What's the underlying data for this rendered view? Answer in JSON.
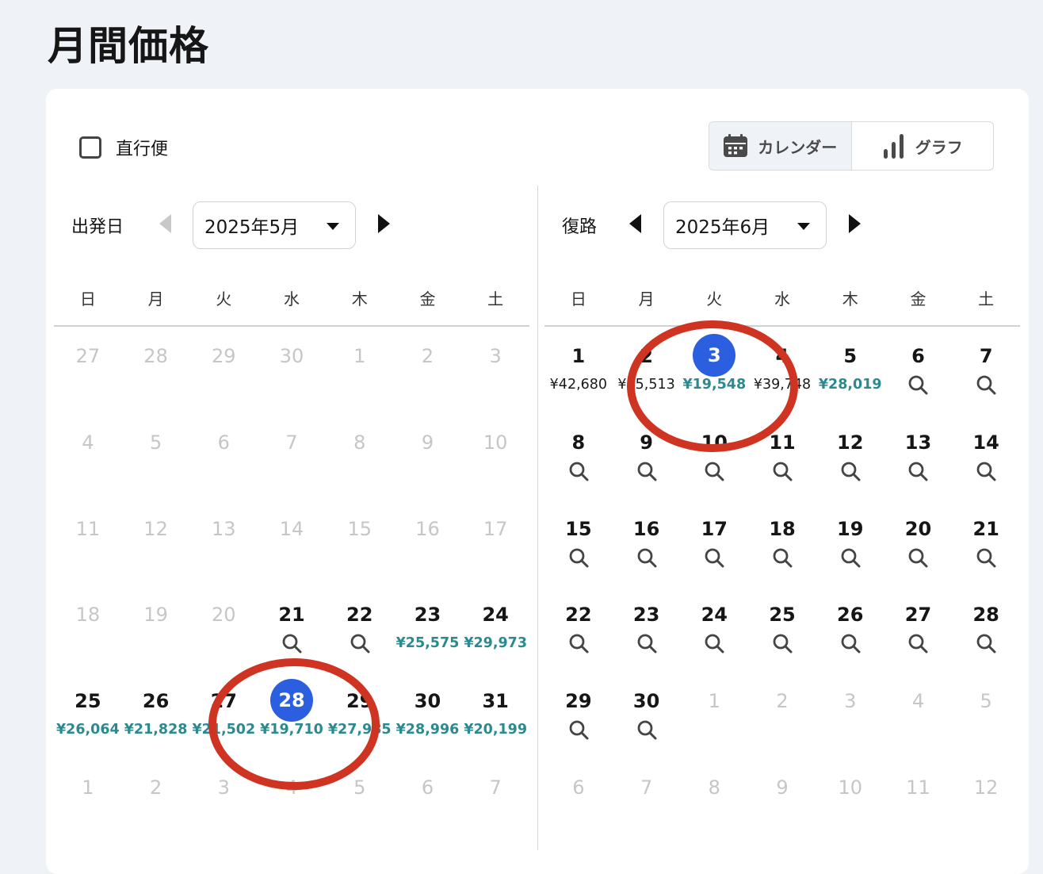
{
  "page_title": "月間価格",
  "filters": {
    "nonstop_label": "直行便",
    "nonstop_checked": false
  },
  "view_toggle": {
    "calendar_label": "カレンダー",
    "graph_label": "グラフ",
    "active": "calendar",
    "calendar_icon": "calendar-icon",
    "graph_icon": "bar-chart-icon"
  },
  "colors": {
    "accent": "#2c5fe0",
    "cheap_price": "#2b8a8f",
    "annotation": "#cf3322",
    "muted": "#c6c6c6"
  },
  "weekdays": [
    "日",
    "月",
    "火",
    "水",
    "木",
    "金",
    "土"
  ],
  "departure": {
    "label": "出発日",
    "month": "2025年5月",
    "prev_enabled": false,
    "weeks": [
      [
        {
          "d": "27",
          "muted": true
        },
        {
          "d": "28",
          "muted": true
        },
        {
          "d": "29",
          "muted": true
        },
        {
          "d": "30",
          "muted": true
        },
        {
          "d": "1",
          "muted": true
        },
        {
          "d": "2",
          "muted": true
        },
        {
          "d": "3",
          "muted": true
        }
      ],
      [
        {
          "d": "4",
          "muted": true
        },
        {
          "d": "5",
          "muted": true
        },
        {
          "d": "6",
          "muted": true
        },
        {
          "d": "7",
          "muted": true
        },
        {
          "d": "8",
          "muted": true
        },
        {
          "d": "9",
          "muted": true
        },
        {
          "d": "10",
          "muted": true
        }
      ],
      [
        {
          "d": "11",
          "muted": true
        },
        {
          "d": "12",
          "muted": true
        },
        {
          "d": "13",
          "muted": true
        },
        {
          "d": "14",
          "muted": true
        },
        {
          "d": "15",
          "muted": true
        },
        {
          "d": "16",
          "muted": true
        },
        {
          "d": "17",
          "muted": true
        }
      ],
      [
        {
          "d": "18",
          "muted": true
        },
        {
          "d": "19",
          "muted": true
        },
        {
          "d": "20",
          "muted": true
        },
        {
          "d": "21",
          "search": true
        },
        {
          "d": "22",
          "search": true
        },
        {
          "d": "23",
          "price": "¥25,575",
          "cheap": true
        },
        {
          "d": "24",
          "price": "¥29,973",
          "cheap": true
        }
      ],
      [
        {
          "d": "25",
          "price": "¥26,064",
          "cheap": true
        },
        {
          "d": "26",
          "price": "¥21,828",
          "cheap": true
        },
        {
          "d": "27",
          "price": "¥21,502",
          "cheap": true
        },
        {
          "d": "28",
          "price": "¥19,710",
          "cheap": true,
          "selected": true
        },
        {
          "d": "29",
          "price": "¥27,985",
          "cheap": true
        },
        {
          "d": "30",
          "price": "¥28,996",
          "cheap": true
        },
        {
          "d": "31",
          "price": "¥20,199",
          "cheap": true
        }
      ],
      [
        {
          "d": "1",
          "muted": true
        },
        {
          "d": "2",
          "muted": true
        },
        {
          "d": "3",
          "muted": true
        },
        {
          "d": "4",
          "muted": true
        },
        {
          "d": "5",
          "muted": true
        },
        {
          "d": "6",
          "muted": true
        },
        {
          "d": "7",
          "muted": true
        }
      ]
    ]
  },
  "return": {
    "label": "復路",
    "month": "2025年6月",
    "prev_enabled": true,
    "weeks": [
      [
        {
          "d": "1",
          "price": "¥42,680",
          "cheap": false
        },
        {
          "d": "2",
          "price": "¥35,513",
          "cheap": false
        },
        {
          "d": "3",
          "price": "¥19,548",
          "cheap": true,
          "selected": true
        },
        {
          "d": "4",
          "price": "¥39,748",
          "cheap": false
        },
        {
          "d": "5",
          "price": "¥28,019",
          "cheap": true
        },
        {
          "d": "6",
          "search": true
        },
        {
          "d": "7",
          "search": true
        }
      ],
      [
        {
          "d": "8",
          "search": true
        },
        {
          "d": "9",
          "search": true
        },
        {
          "d": "10",
          "search": true
        },
        {
          "d": "11",
          "search": true
        },
        {
          "d": "12",
          "search": true
        },
        {
          "d": "13",
          "search": true
        },
        {
          "d": "14",
          "search": true
        }
      ],
      [
        {
          "d": "15",
          "search": true
        },
        {
          "d": "16",
          "search": true
        },
        {
          "d": "17",
          "search": true
        },
        {
          "d": "18",
          "search": true
        },
        {
          "d": "19",
          "search": true
        },
        {
          "d": "20",
          "search": true
        },
        {
          "d": "21",
          "search": true
        }
      ],
      [
        {
          "d": "22",
          "search": true
        },
        {
          "d": "23",
          "search": true
        },
        {
          "d": "24",
          "search": true
        },
        {
          "d": "25",
          "search": true
        },
        {
          "d": "26",
          "search": true
        },
        {
          "d": "27",
          "search": true
        },
        {
          "d": "28",
          "search": true
        }
      ],
      [
        {
          "d": "29",
          "search": true
        },
        {
          "d": "30",
          "search": true
        },
        {
          "d": "1",
          "muted": true
        },
        {
          "d": "2",
          "muted": true
        },
        {
          "d": "3",
          "muted": true
        },
        {
          "d": "4",
          "muted": true
        },
        {
          "d": "5",
          "muted": true
        }
      ],
      [
        {
          "d": "6",
          "muted": true
        },
        {
          "d": "7",
          "muted": true
        },
        {
          "d": "8",
          "muted": true
        },
        {
          "d": "9",
          "muted": true
        },
        {
          "d": "10",
          "muted": true
        },
        {
          "d": "11",
          "muted": true
        },
        {
          "d": "12",
          "muted": true
        }
      ]
    ]
  }
}
